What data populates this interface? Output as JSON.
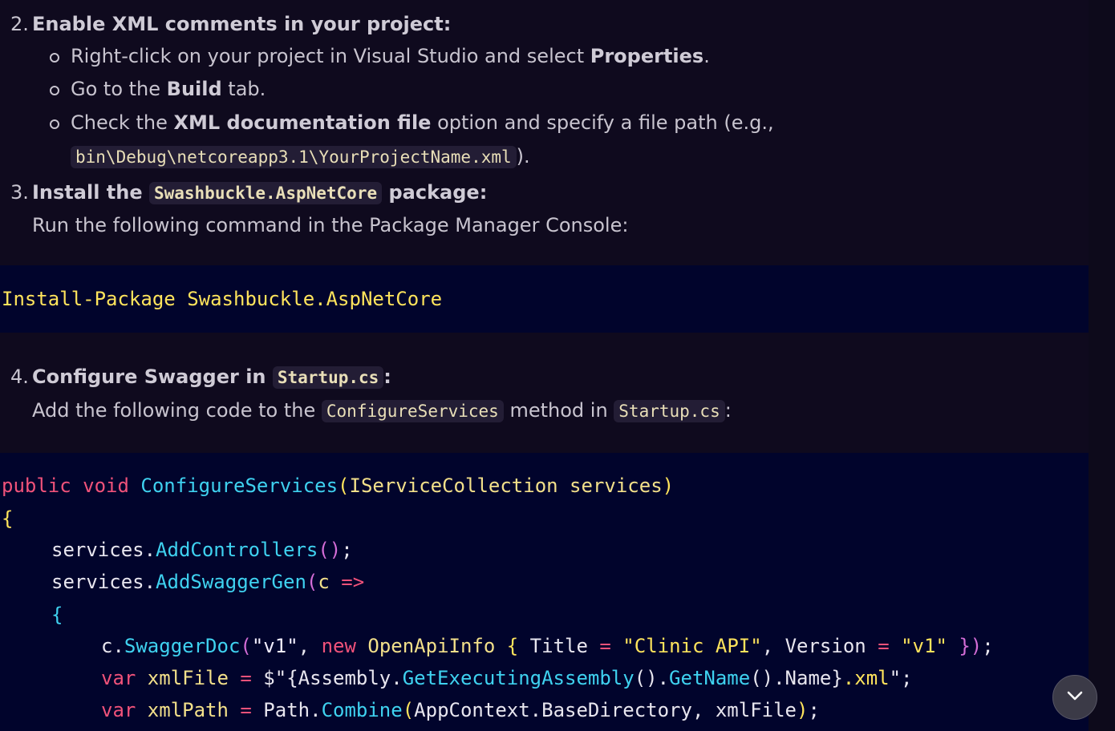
{
  "step2": {
    "number": "2.",
    "title": "Enable XML comments in your project:",
    "bullet1_pre": "Right-click on your project in Visual Studio and select ",
    "bullet1_bold": "Properties",
    "bullet1_post": ".",
    "bullet2_pre": "Go to the ",
    "bullet2_bold": "Build",
    "bullet2_post": " tab.",
    "bullet3_pre": "Check the ",
    "bullet3_bold": "XML documentation file",
    "bullet3_post": " option and specify a file path (e.g.,",
    "bullet3_code": "bin\\Debug\\netcoreapp3.1\\YourProjectName.xml",
    "bullet3_end": ")."
  },
  "step3": {
    "number": "3.",
    "title_pre": "Install the ",
    "title_code": "Swashbuckle.AspNetCore",
    "title_post": " package:",
    "desc": "Run the following command in the Package Manager Console:",
    "command_kw": "Install-Package",
    "command_arg": "Swashbuckle.AspNetCore"
  },
  "step4": {
    "number": "4.",
    "title_pre": "Configure Swagger in ",
    "title_code": "Startup.cs",
    "title_post": ":",
    "desc_pre": "Add the following code to the ",
    "desc_code1": "ConfigureServices",
    "desc_mid": " method in ",
    "desc_code2": "Startup.cs",
    "desc_post": ":"
  },
  "code": {
    "l1": [
      "public",
      "void",
      "ConfigureServices",
      "(",
      "IServiceCollection",
      " services",
      ")"
    ],
    "l2": "{",
    "l3": [
      "services",
      ".",
      "AddControllers",
      "()",
      ";"
    ],
    "l4": [
      "services",
      ".",
      "AddSwaggerGen",
      "(",
      "c ",
      "=>"
    ],
    "l5": "{",
    "l6": [
      "c",
      ".",
      "SwaggerDoc",
      "(",
      "\"v1\"",
      ", ",
      "new",
      " ",
      "OpenApiInfo",
      " ",
      "{",
      " Title ",
      "=",
      " ",
      "\"Clinic API\"",
      ", Version ",
      "=",
      " ",
      "\"v1\"",
      " ",
      "}",
      ")",
      ";"
    ],
    "l7": [
      "var",
      " xmlFile ",
      "=",
      " $\"{Assembly.",
      "GetExecutingAssembly",
      "().",
      "GetName",
      "().Name}",
      ".xml",
      "\";"
    ],
    "l8": [
      "var",
      " xmlPath ",
      "=",
      " Path.",
      "Combine",
      "(",
      "AppContext.BaseDirectory, xmlFile",
      ")",
      ";"
    ]
  },
  "ui": {
    "scroll_down_icon": "chevron-down-icon"
  }
}
